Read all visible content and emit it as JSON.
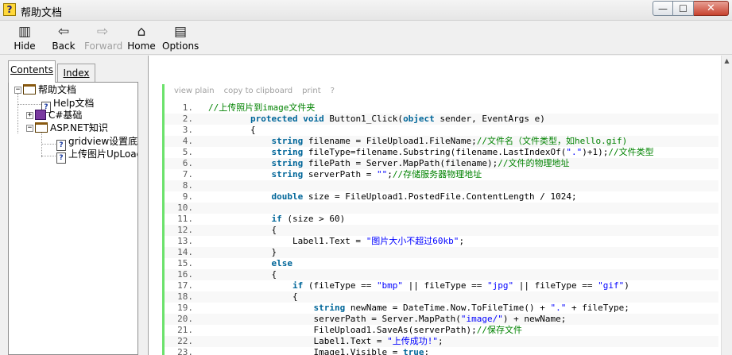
{
  "window": {
    "title": "帮助文档",
    "icon": "help-question-icon",
    "controls": {
      "minimize": "—",
      "maximize": "☐",
      "close": "✕"
    }
  },
  "toolbar": {
    "hide": {
      "label": "Hide",
      "icon": "hide-pane-icon",
      "glyph": "▥"
    },
    "back": {
      "label": "Back",
      "icon": "back-arrow-icon",
      "glyph": "⇦"
    },
    "forward": {
      "label": "Forward",
      "icon": "forward-arrow-icon",
      "glyph": "⇨"
    },
    "home": {
      "label": "Home",
      "icon": "home-icon",
      "glyph": "⌂"
    },
    "options": {
      "label": "Options",
      "icon": "options-icon",
      "glyph": "▤"
    }
  },
  "tabs": {
    "contents": "Contents",
    "index": "Index"
  },
  "tree": {
    "root": "帮助文档",
    "help_doc": "Help文档",
    "csharp": "C#基础",
    "aspnet": "ASP.NET知识",
    "gridview": "gridview设置底",
    "upload": "上传图片UpLoad"
  },
  "code": {
    "toolbar": [
      "view plain",
      "copy to clipboard",
      "print",
      "?"
    ],
    "lines": [
      {
        "n": "1.",
        "text": "//上传照片到image文件夹"
      },
      {
        "n": "2.",
        "text": "        protected void Button1_Click(object sender, EventArgs e)"
      },
      {
        "n": "3.",
        "text": "        {"
      },
      {
        "n": "4.",
        "text": "            string filename = FileUpload1.FileName;//文件名（文件类型，如hello.gif)"
      },
      {
        "n": "5.",
        "text": "            string fileType=filename.Substring(filename.LastIndexOf(\".\")+1);//文件类型"
      },
      {
        "n": "6.",
        "text": "            string filePath = Server.MapPath(filename);//文件的物理地址"
      },
      {
        "n": "7.",
        "text": "            string serverPath = \"\";//存储服务器物理地址"
      },
      {
        "n": "8.",
        "text": ""
      },
      {
        "n": "9.",
        "text": "            double size = FileUpload1.PostedFile.ContentLength / 1024;"
      },
      {
        "n": "10.",
        "text": ""
      },
      {
        "n": "11.",
        "text": "            if (size > 60)"
      },
      {
        "n": "12.",
        "text": "            {"
      },
      {
        "n": "13.",
        "text": "                Label1.Text = \"图片大小不超过60kb\";"
      },
      {
        "n": "14.",
        "text": "            }"
      },
      {
        "n": "15.",
        "text": "            else"
      },
      {
        "n": "16.",
        "text": "            {"
      },
      {
        "n": "17.",
        "text": "                if (fileType == \"bmp\" || fileType == \"jpg\" || fileType == \"gif\")"
      },
      {
        "n": "18.",
        "text": "                {"
      },
      {
        "n": "19.",
        "text": "                    string newName = DateTime.Now.ToFileTime() + \".\" + fileType;"
      },
      {
        "n": "20.",
        "text": "                    serverPath = Server.MapPath(\"image/\") + newName;"
      },
      {
        "n": "21.",
        "text": "                    FileUpload1.SaveAs(serverPath);//保存文件"
      },
      {
        "n": "22.",
        "text": "                    Label1.Text = \"上传成功!\";"
      },
      {
        "n": "23.",
        "text": "                    Image1.Visible = true;"
      }
    ]
  },
  "colors": {
    "keyword": "#006699",
    "string": "#0000ff",
    "comment": "#008200",
    "gutter_bar": "#6ce26c"
  }
}
